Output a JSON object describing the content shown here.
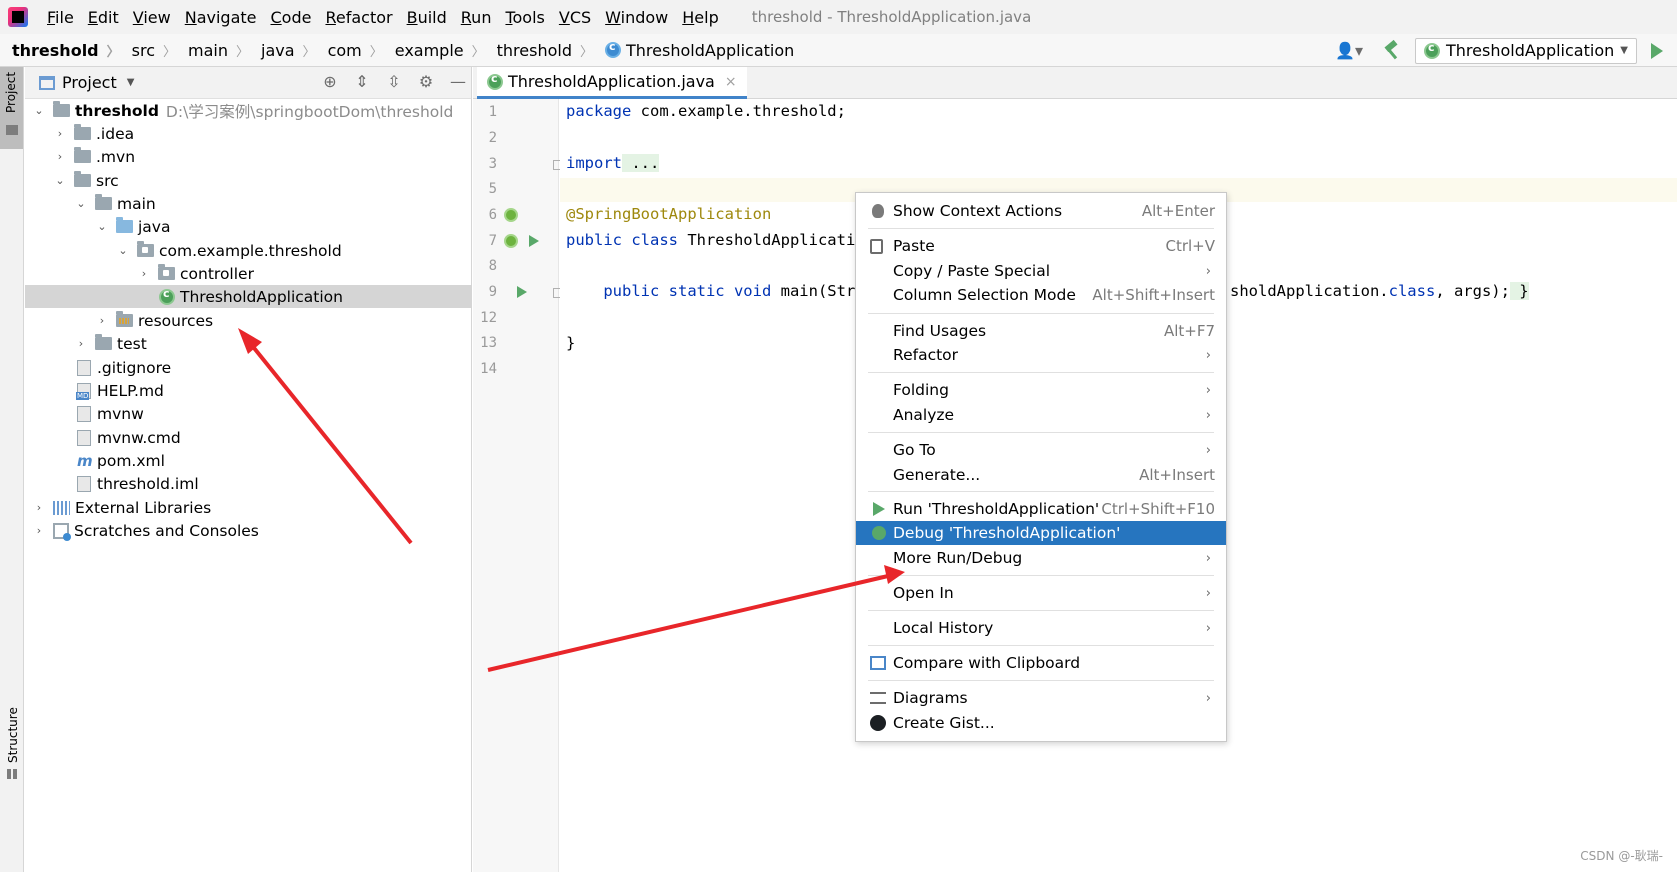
{
  "menubar": {
    "items": [
      "File",
      "Edit",
      "View",
      "Navigate",
      "Code",
      "Refactor",
      "Build",
      "Run",
      "Tools",
      "VCS",
      "Window",
      "Help"
    ],
    "window_title": "threshold - ThresholdApplication.java"
  },
  "breadcrumb": {
    "items": [
      "threshold",
      "src",
      "main",
      "java",
      "com",
      "example",
      "threshold"
    ],
    "current": "ThresholdApplication"
  },
  "run_config": {
    "label": "ThresholdApplication"
  },
  "stripe": {
    "project": "Project",
    "structure": "Structure"
  },
  "project_panel": {
    "title": "Project",
    "tree": [
      {
        "label": "threshold",
        "path": "D:\\学习案例\\springbootDom\\threshold"
      },
      {
        "label": ".idea"
      },
      {
        "label": ".mvn"
      },
      {
        "label": "src"
      },
      {
        "label": "main"
      },
      {
        "label": "java"
      },
      {
        "label": "com.example.threshold"
      },
      {
        "label": "controller"
      },
      {
        "label": "ThresholdApplication"
      },
      {
        "label": "resources"
      },
      {
        "label": "test"
      },
      {
        "label": ".gitignore"
      },
      {
        "label": "HELP.md"
      },
      {
        "label": "mvnw"
      },
      {
        "label": "mvnw.cmd"
      },
      {
        "label": "pom.xml"
      },
      {
        "label": "threshold.iml"
      },
      {
        "label": "External Libraries"
      },
      {
        "label": "Scratches and Consoles"
      }
    ]
  },
  "editor": {
    "tab": "ThresholdApplication.java",
    "line_numbers": [
      "1",
      "2",
      "3",
      "5",
      "6",
      "7",
      "8",
      "9",
      "12",
      "13",
      "14"
    ],
    "code": {
      "l1_kw": "package",
      "l1_rest": " com.example.threshold;",
      "l3_kw": "import",
      "l3_fold": " ...",
      "l6_ann": "@SpringBootApplication",
      "l7_kw": "public class",
      "l7_rest": " ThresholdApplicati",
      "l9_kw": "    public static void",
      "l9_rest": " main(Str",
      "l9_tail": "sholdApplication.",
      "l9_kw2": "class",
      "l9_end": ", args);",
      "l9_brace": " }",
      "l13": "}"
    }
  },
  "context_menu": {
    "items": [
      {
        "label": "Show Context Actions",
        "shortcut": "Alt+Enter"
      },
      {
        "label": "Paste",
        "shortcut": "Ctrl+V"
      },
      {
        "label": "Copy / Paste Special",
        "arrow": "›"
      },
      {
        "label": "Column Selection Mode",
        "shortcut": "Alt+Shift+Insert"
      },
      {
        "label": "Find Usages",
        "shortcut": "Alt+F7"
      },
      {
        "label": "Refactor",
        "arrow": "›"
      },
      {
        "label": "Folding",
        "arrow": "›"
      },
      {
        "label": "Analyze",
        "arrow": "›"
      },
      {
        "label": "Go To",
        "arrow": "›"
      },
      {
        "label": "Generate...",
        "shortcut": "Alt+Insert"
      },
      {
        "label": "Run 'ThresholdApplication'",
        "shortcut": "Ctrl+Shift+F10"
      },
      {
        "label": "Debug 'ThresholdApplication'"
      },
      {
        "label": "More Run/Debug",
        "arrow": "›"
      },
      {
        "label": "Open In",
        "arrow": "›"
      },
      {
        "label": "Local History",
        "arrow": "›"
      },
      {
        "label": "Compare with Clipboard"
      },
      {
        "label": "Diagrams",
        "arrow": "›"
      },
      {
        "label": "Create Gist..."
      }
    ]
  },
  "watermark": "CSDN @-耿瑞-",
  "colors": {
    "selection": "#2675bf",
    "annotation_arrows": "#e8262a",
    "keyword": "#0033b3"
  }
}
